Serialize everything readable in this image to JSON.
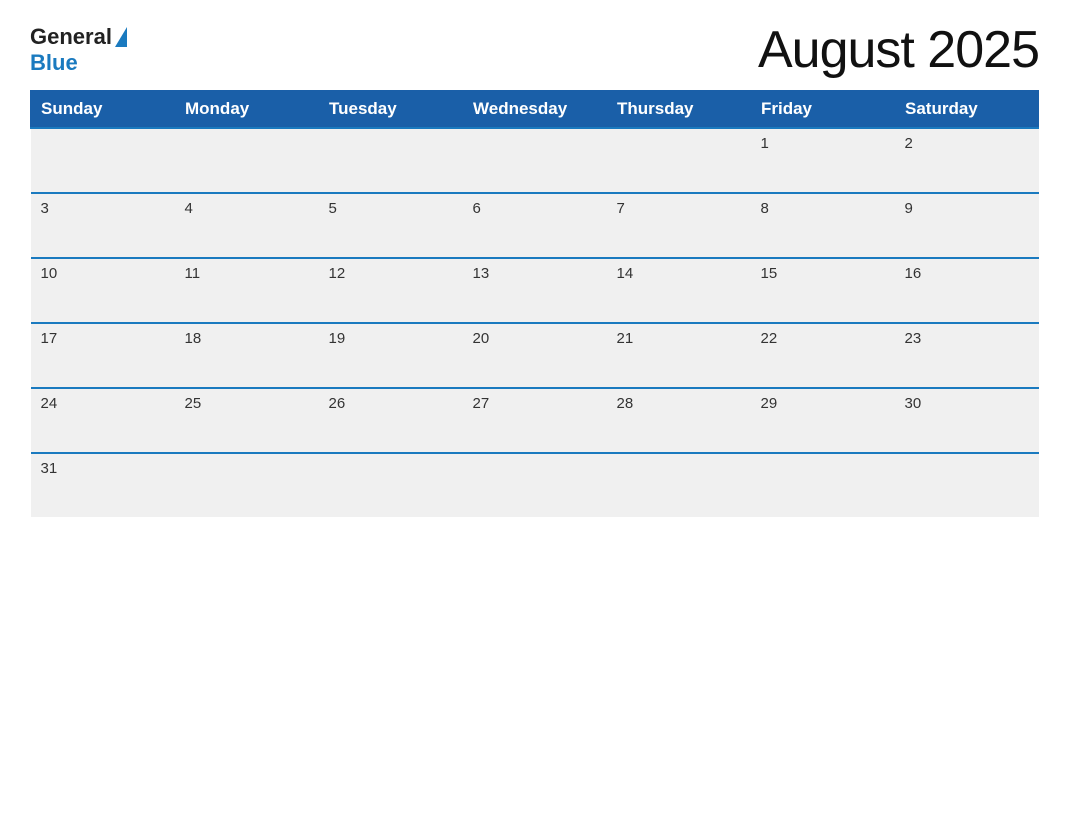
{
  "logo": {
    "general": "General",
    "blue": "Blue"
  },
  "title": "August 2025",
  "days_of_week": [
    "Sunday",
    "Monday",
    "Tuesday",
    "Wednesday",
    "Thursday",
    "Friday",
    "Saturday"
  ],
  "weeks": [
    [
      null,
      null,
      null,
      null,
      null,
      1,
      2
    ],
    [
      3,
      4,
      5,
      6,
      7,
      8,
      9
    ],
    [
      10,
      11,
      12,
      13,
      14,
      15,
      16
    ],
    [
      17,
      18,
      19,
      20,
      21,
      22,
      23
    ],
    [
      24,
      25,
      26,
      27,
      28,
      29,
      30
    ],
    [
      31,
      null,
      null,
      null,
      null,
      null,
      null
    ]
  ]
}
